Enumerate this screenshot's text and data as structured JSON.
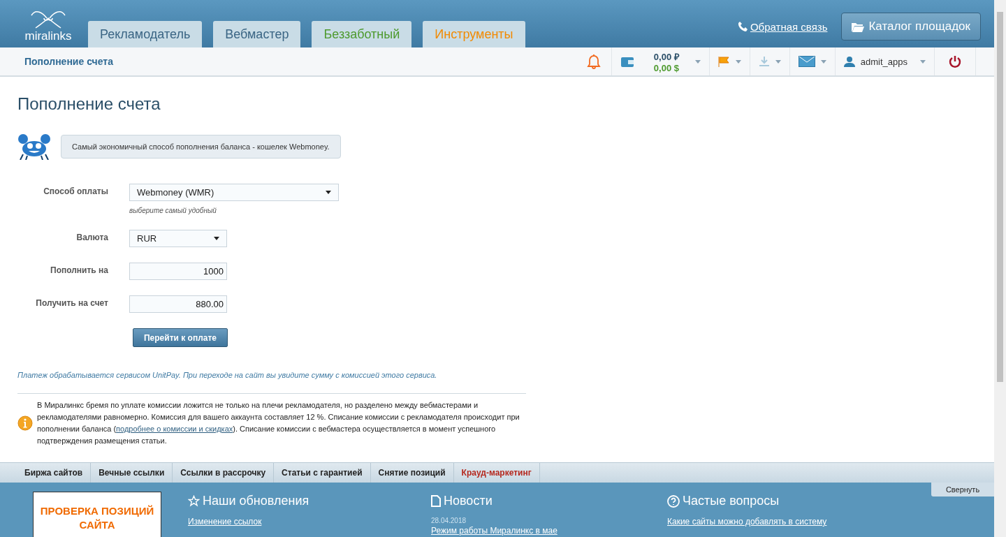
{
  "header": {
    "logo": "miralinks",
    "tabs": [
      {
        "label": "Рекламодатель",
        "color": "#3a6584"
      },
      {
        "label": "Вебмастер",
        "color": "#3a6584"
      },
      {
        "label": "Беззаботный",
        "color": "#4e9a2e"
      },
      {
        "label": "Инструменты",
        "color": "#f28a00"
      }
    ],
    "feedback": "Обратная связь",
    "catalog": "Каталог площадок"
  },
  "subbar": {
    "title": "Пополнение счета",
    "balance_rub": "0,00 ₽",
    "balance_usd": "0,00 $",
    "user": "admit_apps"
  },
  "page": {
    "title": "Пополнение счета",
    "tip": "Самый экономичный способ пополнения баланса - кошелек Webmoney.",
    "fields": [
      {
        "kind": "select",
        "label": "Способ оплаты",
        "value": "Webmoney (WMR)",
        "hint": "выберите самый удобный",
        "wide": true
      },
      {
        "kind": "select",
        "label": "Валюта",
        "value": "RUR",
        "wide": false
      },
      {
        "kind": "input",
        "label": "Пополнить на",
        "value": "1000",
        "wide": false
      },
      {
        "kind": "input",
        "label": "Получить на счет",
        "value": "880.00",
        "wide": false
      }
    ],
    "submit": "Перейти к оплате",
    "note": "Платеж обрабатывается сервисом UnitPay. При переходе на сайт вы увидите сумму с комиссией этого сервиса.",
    "info_before": "В Миралинкс бремя по уплате комиссии ложится не только на плечи рекламодателя, но разделено между вебмастерами и рекламодателями равномерно. Комиссия для вашего аккаунта составляет 12 %. Списание комиссии с рекламодателя происходит при пополнении баланса (",
    "info_link": "подробнее о комиссии и скидках",
    "info_after": "). Списание комиссии с вебмастера осуществляется в момент успешного подтверждения размещения статьи."
  },
  "footer_nav": [
    {
      "label": "Биржа сайтов",
      "color": "#222222"
    },
    {
      "label": "Вечные ссылки",
      "color": "#222222"
    },
    {
      "label": "Ссылки в рассрочку",
      "color": "#222222"
    },
    {
      "label": "Статьи с гарантией",
      "color": "#222222"
    },
    {
      "label": "Снятие позиций",
      "color": "#222222"
    },
    {
      "label": "Крауд-маркетинг",
      "color": "#b5281e"
    }
  ],
  "footer": {
    "collapse": "Свернуть",
    "promo": "ПРОВЕРКА ПОЗИЦИЙ САЙТА",
    "columns": [
      {
        "kind": "updates",
        "title": "Наши обновления",
        "items": [
          {
            "text": "Изменение ссылок"
          }
        ]
      },
      {
        "kind": "news",
        "title": "Новости",
        "items": [
          {
            "date": "28.04.2018",
            "text": "Режим работы Миралинкс в мае"
          }
        ]
      },
      {
        "kind": "faq",
        "title": "Частые вопросы",
        "items": [
          {
            "text": "Какие сайты можно добавлять в систему"
          }
        ]
      }
    ]
  }
}
